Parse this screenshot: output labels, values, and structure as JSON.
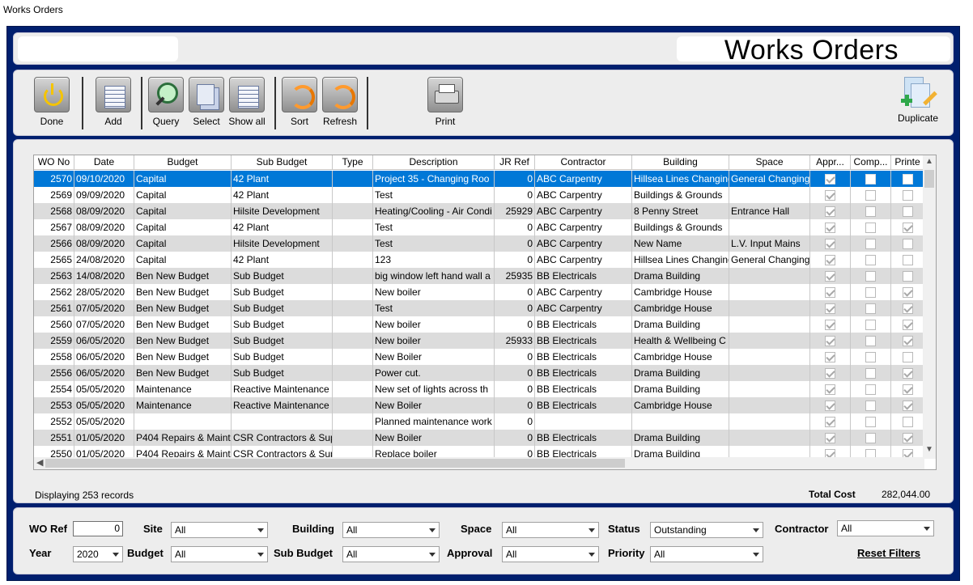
{
  "window": {
    "title": "Works Orders"
  },
  "header": {
    "title": "Works Orders"
  },
  "toolbar": {
    "done": "Done",
    "add": "Add",
    "query": "Query",
    "select": "Select",
    "show_all": "Show all",
    "sort": "Sort",
    "refresh": "Refresh",
    "print": "Print",
    "duplicate": "Duplicate"
  },
  "grid": {
    "columns": [
      "WO No",
      "Date",
      "Budget",
      "Sub Budget",
      "Type",
      "Description",
      "JR Ref",
      "Contractor",
      "Building",
      "Space",
      "Appr...",
      "Comp...",
      "Printe"
    ],
    "rows": [
      {
        "wo": "2570",
        "date": "09/10/2020",
        "budget": "Capital",
        "sub": "42 Plant",
        "type": "",
        "desc": "Project 35 - Changing  Roo",
        "jr": "0",
        "contractor": "ABC Carpentry",
        "building": "Hillsea Lines Changing",
        "space": "General Changing",
        "appr": true,
        "comp": false,
        "printed": false
      },
      {
        "wo": "2569",
        "date": "09/09/2020",
        "budget": "Capital",
        "sub": "42 Plant",
        "type": "",
        "desc": "Test",
        "jr": "0",
        "contractor": "ABC Carpentry",
        "building": "Buildings & Grounds",
        "space": "",
        "appr": true,
        "comp": false,
        "printed": false
      },
      {
        "wo": "2568",
        "date": "08/09/2020",
        "budget": "Capital",
        "sub": "Hilsite Development",
        "type": "",
        "desc": "Heating/Cooling - Air Condi",
        "jr": "25929",
        "contractor": "ABC Carpentry",
        "building": "8 Penny Street",
        "space": "Entrance Hall",
        "appr": true,
        "comp": false,
        "printed": false
      },
      {
        "wo": "2567",
        "date": "08/09/2020",
        "budget": "Capital",
        "sub": "42 Plant",
        "type": "",
        "desc": "Test",
        "jr": "0",
        "contractor": "ABC Carpentry",
        "building": "Buildings & Grounds",
        "space": "",
        "appr": true,
        "comp": false,
        "printed": true
      },
      {
        "wo": "2566",
        "date": "08/09/2020",
        "budget": "Capital",
        "sub": "Hilsite Development",
        "type": "",
        "desc": "Test",
        "jr": "0",
        "contractor": "ABC Carpentry",
        "building": "New Name",
        "space": "L.V. Input Mains",
        "appr": true,
        "comp": false,
        "printed": false
      },
      {
        "wo": "2565",
        "date": "24/08/2020",
        "budget": "Capital",
        "sub": "42 Plant",
        "type": "",
        "desc": "123",
        "jr": "0",
        "contractor": "ABC Carpentry",
        "building": "Hillsea Lines Changing",
        "space": "General Changing",
        "appr": true,
        "comp": false,
        "printed": false
      },
      {
        "wo": "2563",
        "date": "14/08/2020",
        "budget": "Ben New Budget",
        "sub": "Sub Budget",
        "type": "",
        "desc": "big window left hand wall a",
        "jr": "25935",
        "contractor": "BB Electricals",
        "building": "Drama Building",
        "space": "",
        "appr": true,
        "comp": false,
        "printed": false
      },
      {
        "wo": "2562",
        "date": "28/05/2020",
        "budget": "Ben New Budget",
        "sub": "Sub Budget",
        "type": "",
        "desc": "New boiler",
        "jr": "0",
        "contractor": "ABC Carpentry",
        "building": "Cambridge House",
        "space": "",
        "appr": true,
        "comp": false,
        "printed": true
      },
      {
        "wo": "2561",
        "date": "07/05/2020",
        "budget": "Ben New Budget",
        "sub": "Sub Budget",
        "type": "",
        "desc": "Test",
        "jr": "0",
        "contractor": "ABC Carpentry",
        "building": "Cambridge House",
        "space": "",
        "appr": true,
        "comp": false,
        "printed": true
      },
      {
        "wo": "2560",
        "date": "07/05/2020",
        "budget": "Ben New Budget",
        "sub": "Sub Budget",
        "type": "",
        "desc": "New boiler",
        "jr": "0",
        "contractor": "BB Electricals",
        "building": "Drama Building",
        "space": "",
        "appr": true,
        "comp": false,
        "printed": true
      },
      {
        "wo": "2559",
        "date": "06/05/2020",
        "budget": "Ben New Budget",
        "sub": "Sub Budget",
        "type": "",
        "desc": "New boiler",
        "jr": "25933",
        "contractor": "BB Electricals",
        "building": "Health & Wellbeing C",
        "space": "",
        "appr": true,
        "comp": false,
        "printed": true
      },
      {
        "wo": "2558",
        "date": "06/05/2020",
        "budget": "Ben New Budget",
        "sub": "Sub Budget",
        "type": "",
        "desc": "New Boiler",
        "jr": "0",
        "contractor": "BB Electricals",
        "building": "Cambridge House",
        "space": "",
        "appr": true,
        "comp": false,
        "printed": false
      },
      {
        "wo": "2556",
        "date": "06/05/2020",
        "budget": "Ben New Budget",
        "sub": "Sub Budget",
        "type": "",
        "desc": "Power cut.",
        "jr": "0",
        "contractor": "BB Electricals",
        "building": "Drama Building",
        "space": "",
        "appr": true,
        "comp": false,
        "printed": true
      },
      {
        "wo": "2554",
        "date": "05/05/2020",
        "budget": "Maintenance",
        "sub": "Reactive Maintenance",
        "type": "",
        "desc": "New set of lights across th",
        "jr": "0",
        "contractor": "BB Electricals",
        "building": "Drama Building",
        "space": "",
        "appr": true,
        "comp": false,
        "printed": true
      },
      {
        "wo": "2553",
        "date": "05/05/2020",
        "budget": "Maintenance",
        "sub": "Reactive Maintenance",
        "type": "",
        "desc": "New Boiler",
        "jr": "0",
        "contractor": "BB Electricals",
        "building": "Cambridge House",
        "space": "",
        "appr": true,
        "comp": false,
        "printed": true
      },
      {
        "wo": "2552",
        "date": "05/05/2020",
        "budget": "",
        "sub": "",
        "type": "",
        "desc": "Planned maintenance work",
        "jr": "0",
        "contractor": "",
        "building": "",
        "space": "",
        "appr": true,
        "comp": false,
        "printed": false
      },
      {
        "wo": "2551",
        "date": "01/05/2020",
        "budget": "P404 Repairs & Maint",
        "sub": "CSR Contractors & Sup",
        "type": "",
        "desc": "New Boiler",
        "jr": "0",
        "contractor": "BB Electricals",
        "building": "Drama Building",
        "space": "",
        "appr": true,
        "comp": false,
        "printed": true
      },
      {
        "wo": "2550",
        "date": "01/05/2020",
        "budget": "P404 Repairs & Maint",
        "sub": "CSR Contractors & Sup",
        "type": "",
        "desc": "Replace boiler",
        "jr": "0",
        "contractor": "BB Electricals",
        "building": "Drama Building",
        "space": "",
        "appr": true,
        "comp": false,
        "printed": true
      }
    ]
  },
  "footer": {
    "records": "Displaying 253 records",
    "total_label": "Total Cost",
    "total_value": "282,044.00"
  },
  "filters": {
    "wo_ref_label": "WO Ref",
    "wo_ref_value": "0",
    "site_label": "Site",
    "site_value": "All",
    "building_label": "Building",
    "building_value": "All",
    "space_label": "Space",
    "space_value": "All",
    "status_label": "Status",
    "status_value": "Outstanding",
    "contractor_label": "Contractor",
    "contractor_value": "All",
    "year_label": "Year",
    "year_value": "2020",
    "budget_label": "Budget",
    "budget_value": "All",
    "sub_budget_label": "Sub Budget",
    "sub_budget_value": "All",
    "approval_label": "Approval",
    "approval_value": "All",
    "priority_label": "Priority",
    "priority_value": "All",
    "reset_label": "Reset Filters"
  }
}
